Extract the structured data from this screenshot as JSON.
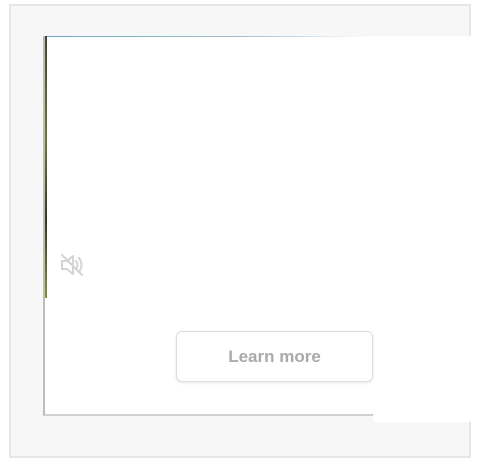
{
  "ad": {
    "cta_label": "Learn more",
    "mute_icon": "speaker-muted-icon"
  },
  "colors": {
    "frame_background": "#f7f7f7",
    "frame_border": "#e6e6e6",
    "cta_text": "#a9a9a9",
    "icon": "#d6d6d6"
  }
}
